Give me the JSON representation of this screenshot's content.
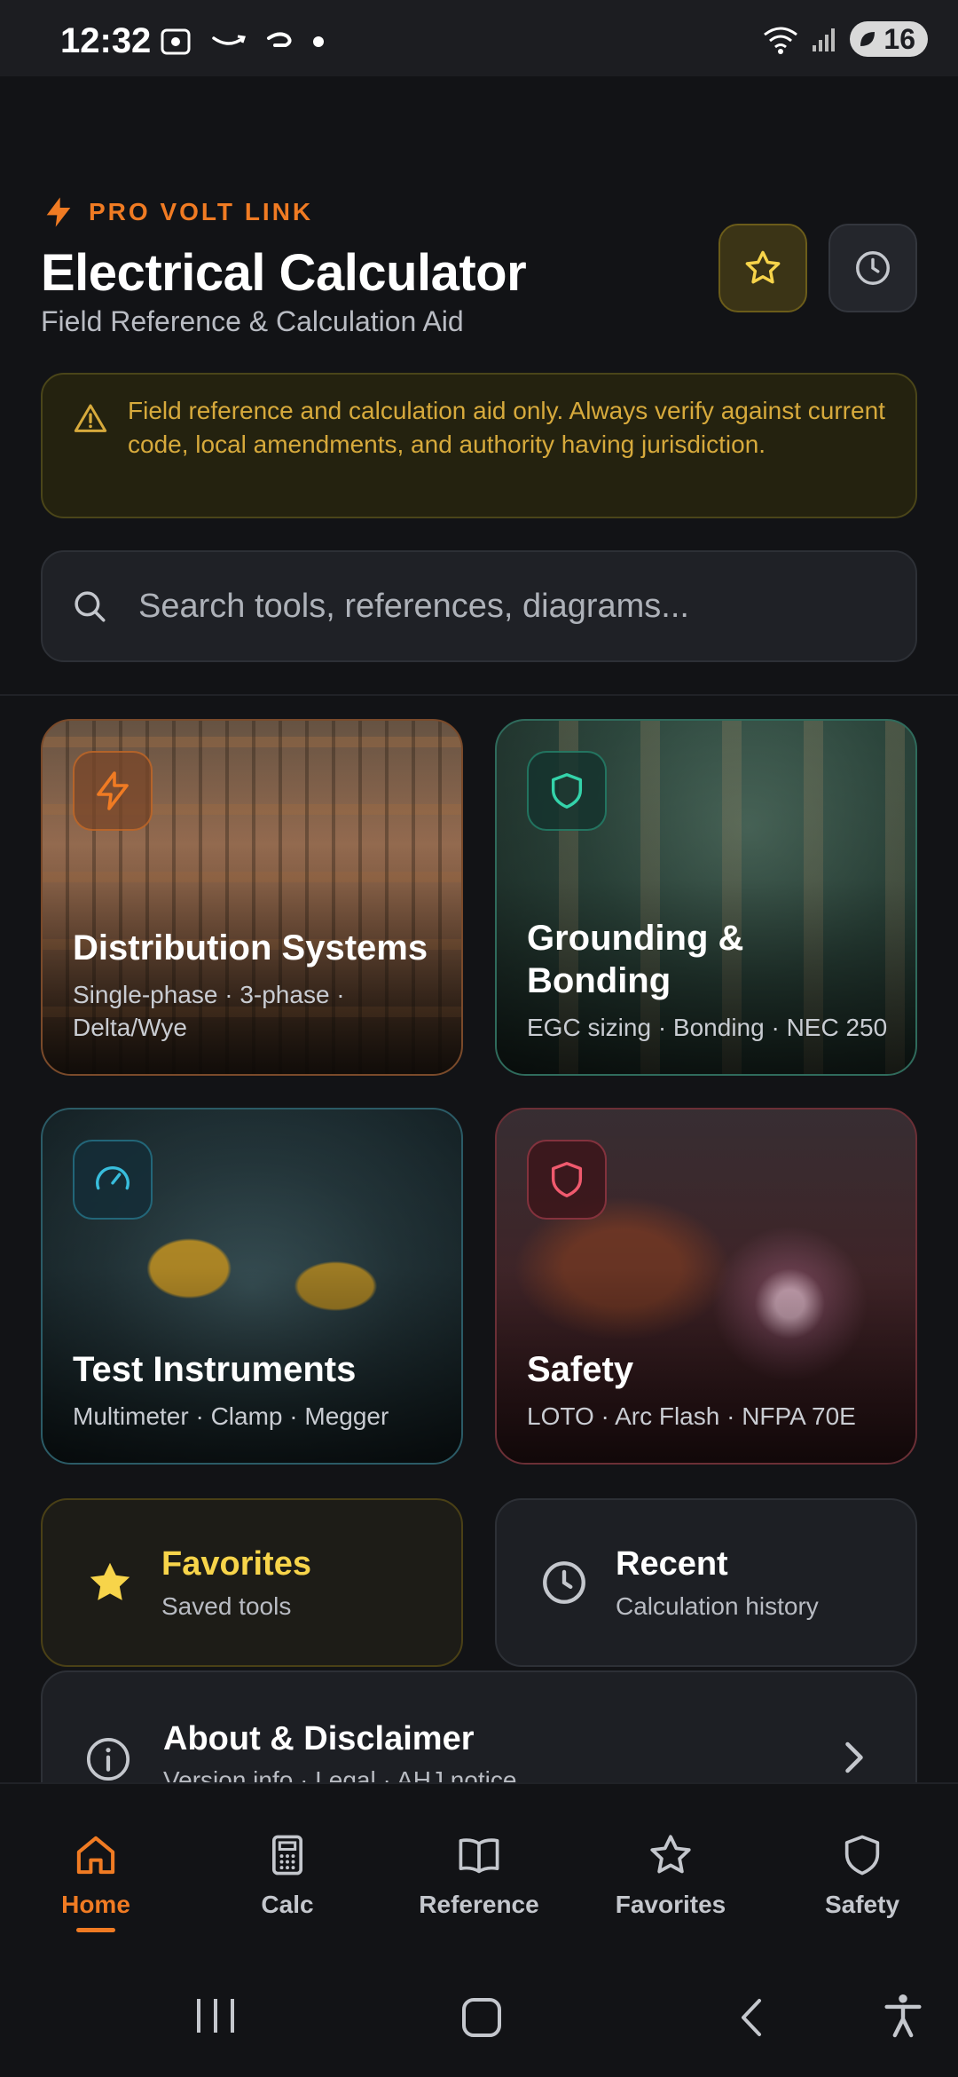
{
  "status_bar": {
    "time": "12:32",
    "battery": "16"
  },
  "header": {
    "brand": "PRO VOLT LINK",
    "title": "Electrical Calculator",
    "subtitle": "Field Reference & Calculation Aid"
  },
  "disclaimer": {
    "text": "Field reference and calculation aid only. Always verify against current code, local amendments, and authority having jurisdiction."
  },
  "search": {
    "placeholder": "Search tools, references, diagrams..."
  },
  "cards": [
    {
      "title": "Distribution Systems",
      "subtitle": "Single-phase · 3-phase · Delta/Wye",
      "icon": "lightning-icon",
      "accent": "#f07b23"
    },
    {
      "title": "Grounding & Bonding",
      "subtitle": "EGC sizing · Bonding · NEC 250",
      "icon": "shield-icon",
      "accent": "#34d3aa"
    },
    {
      "title": "Test Instruments",
      "subtitle": "Multimeter · Clamp · Megger",
      "icon": "gauge-icon",
      "accent": "#38bddc"
    },
    {
      "title": "Safety",
      "subtitle": "LOTO · Arc Flash · NFPA 70E",
      "icon": "shield-icon",
      "accent": "#f05a6e"
    }
  ],
  "tiles": {
    "favorites": {
      "title": "Favorites",
      "subtitle": "Saved tools"
    },
    "recent": {
      "title": "Recent",
      "subtitle": "Calculation history"
    }
  },
  "about": {
    "title": "About & Disclaimer",
    "subtitle": "Version info · Legal · AHJ notice"
  },
  "bottom_nav": [
    {
      "label": "Home",
      "icon": "home-icon",
      "active": true
    },
    {
      "label": "Calc",
      "icon": "calculator-icon",
      "active": false
    },
    {
      "label": "Reference",
      "icon": "book-icon",
      "active": false
    },
    {
      "label": "Favorites",
      "icon": "star-icon",
      "active": false
    },
    {
      "label": "Safety",
      "icon": "shield-icon",
      "active": false
    }
  ],
  "colors": {
    "accent": "#f07b23",
    "favorite": "#f7d44a",
    "warning_text": "#d7aa3c",
    "background": "#121316"
  }
}
